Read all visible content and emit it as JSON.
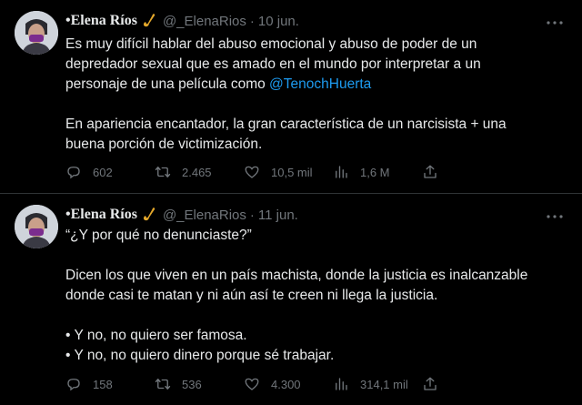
{
  "tweets": [
    {
      "name": "•Elena Ríos",
      "handle": "@_ElenaRios",
      "separator": "·",
      "date": "10 jun.",
      "lines1": [
        "Es muy difícil hablar del abuso emocional y abuso de poder de un",
        "depredador sexual que es amado en el mundo por interpretar a un"
      ],
      "line3_prefix": "personaje de una película como ",
      "mention": "@TenochHuerta",
      "lines2": [
        "En apariencia encantador, la gran característica de un narcisista + una",
        "buena porción de victimización."
      ],
      "stats": {
        "replies": "602",
        "retweets": "2.465",
        "likes": "10,5 mil",
        "views": "1,6 M"
      }
    },
    {
      "name": "•Elena Ríos",
      "handle": "@_ElenaRios",
      "separator": "·",
      "date": "11 jun.",
      "lines": [
        "“¿Y por qué no denunciaste?”",
        "",
        "Dicen los que viven en un país machista, donde la justicia es inalcanzable",
        "donde casi te matan y ni aún así te creen ni llega la justicia.",
        "",
        "• Y no, no quiero ser famosa.",
        "• Y no, no quiero dinero porque sé trabajar."
      ],
      "stats": {
        "replies": "158",
        "retweets": "536",
        "likes": "4.300",
        "views": "314,1 mil"
      }
    }
  ],
  "icons": [
    "more-icon",
    "reply-icon",
    "retweet-icon",
    "like-icon",
    "views-icon",
    "share-icon",
    "saxophone-icon"
  ],
  "colors": {
    "background": "#000000",
    "text": "#e7e9ea",
    "muted": "#71767b",
    "link": "#1d9bf0"
  }
}
